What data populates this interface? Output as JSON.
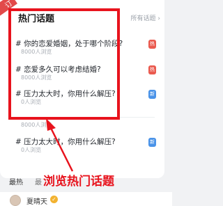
{
  "card": {
    "title": "热门话题",
    "more_link": "所有话题 ›",
    "corner_badge": "订"
  },
  "topics": [
    {
      "title": "# 你的恋爱婚姻，处于哪个阶段?",
      "meta": "8000人浏览",
      "tag": "热",
      "tag_type": "hot"
    },
    {
      "title": "# 恋爱多久可以考虑结婚?",
      "meta": "8000人浏览",
      "tag": "热",
      "tag_type": "hot"
    },
    {
      "title": "# 压力太大时，你用什么解压?",
      "meta": "0人浏览",
      "tag": "新",
      "tag_type": "new"
    },
    {
      "title": "",
      "meta": "8000人浏览",
      "tag": "",
      "tag_type": ""
    },
    {
      "title": "# 压力太大时，你用什么解压?",
      "meta": "0人浏览",
      "tag": "新",
      "tag_type": "new"
    }
  ],
  "annotation": "浏览热门话题",
  "tabs": {
    "hot": "最热",
    "new": "最"
  },
  "user": {
    "name": "夏晴天"
  },
  "colors": {
    "highlight": "#e8131d",
    "tag_hot": "#ea5a4f",
    "tag_new": "#4a93e8"
  }
}
